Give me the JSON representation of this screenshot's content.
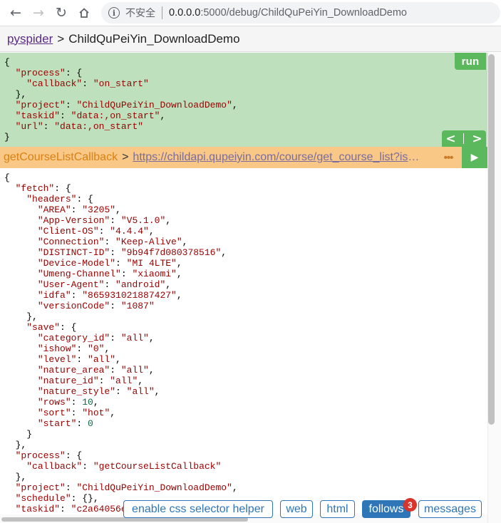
{
  "browser": {
    "insecure_label": "不安全",
    "url_host": "0.0.0.0",
    "url_path": ":5000/debug/ChildQuPeiYin_DownloadDemo"
  },
  "header": {
    "home_link": "pyspider",
    "separator": ">",
    "project_name": "ChildQuPeiYin_DownloadDemo"
  },
  "task_panel": {
    "run_label": "run",
    "prev_label": "<",
    "next_label": ">",
    "json_lines": [
      "{",
      "  \"process\": {",
      "    \"callback\": \"on_start\"",
      "  },",
      "  \"project\": \"ChildQuPeiYin_DownloadDemo\",",
      "  \"taskid\": \"data:,on_start\",",
      "  \"url\": \"data:,on_start\"",
      "}"
    ]
  },
  "follow_bar": {
    "callback": "getCourseListCallback",
    "separator": ">",
    "url": "https://childapi.qupeiyin.com/course/get_course_list?isho...",
    "more_label": "•••",
    "play_label": "▶"
  },
  "result_panel": {
    "json_lines": [
      "{",
      "  \"fetch\": {",
      "    \"headers\": {",
      "      \"AREA\": \"3205\",",
      "      \"App-Version\": \"V5.1.0\",",
      "      \"Client-OS\": \"4.4.4\",",
      "      \"Connection\": \"Keep-Alive\",",
      "      \"DISTINCT-ID\": \"9b94f7d080378516\",",
      "      \"Device-Model\": \"MI 4LTE\",",
      "      \"Umeng-Channel\": \"xiaomi\",",
      "      \"User-Agent\": \"android\",",
      "      \"idfa\": \"865931021887427\",",
      "      \"versionCode\": \"1087\"",
      "    },",
      "    \"save\": {",
      "      \"category_id\": \"all\",",
      "      \"ishow\": \"0\",",
      "      \"level\": \"all\",",
      "      \"nature_area\": \"all\",",
      "      \"nature_id\": \"all\",",
      "      \"nature_style\": \"all\",",
      "      \"rows\": 10,",
      "      \"sort\": \"hot\",",
      "      \"start\": 0",
      "    }",
      "  },",
      "  \"process\": {",
      "    \"callback\": \"getCourseListCallback\"",
      "  },",
      "  \"project\": \"ChildQuPeiYin_DownloadDemo\",",
      "  \"schedule\": {},",
      "  \"taskid\": \"c2a64056e"
    ]
  },
  "toolbar": {
    "css_helper_label": "enable css selector helper",
    "web_label": "web",
    "html_label": "html",
    "follows_label": "follows",
    "follows_count": "3",
    "messages_label": "messages"
  }
}
